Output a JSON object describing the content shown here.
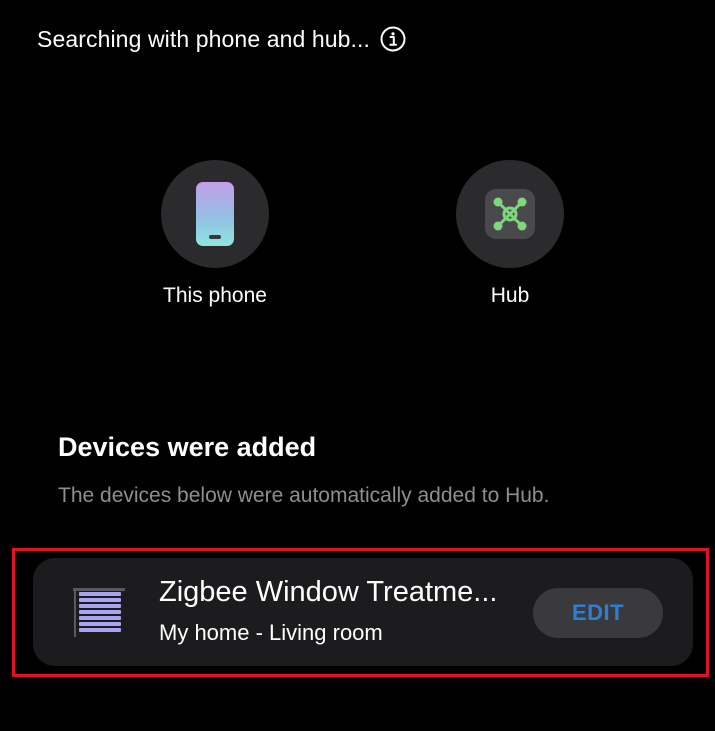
{
  "header": {
    "status_text": "Searching with phone and hub...",
    "info_icon": "info-circle-icon"
  },
  "sources": [
    {
      "label": "This phone",
      "icon": "smartphone-icon"
    },
    {
      "label": "Hub",
      "icon": "hub-network-icon"
    }
  ],
  "devices_section": {
    "title": "Devices were added",
    "description": "The devices below were automatically added to Hub."
  },
  "device": {
    "name": "Zigbee Window Treatme...",
    "location": "My home - Living room",
    "icon": "window-blind-icon",
    "edit_label": "EDIT"
  },
  "colors": {
    "background": "#000000",
    "card": "#1c1c1e",
    "circle": "#2b2b2d",
    "accent_blue": "#2d7fd3",
    "highlight_red": "#e0141e",
    "hub_green": "#7fd67d",
    "secondary_text": "#8e8e93"
  }
}
